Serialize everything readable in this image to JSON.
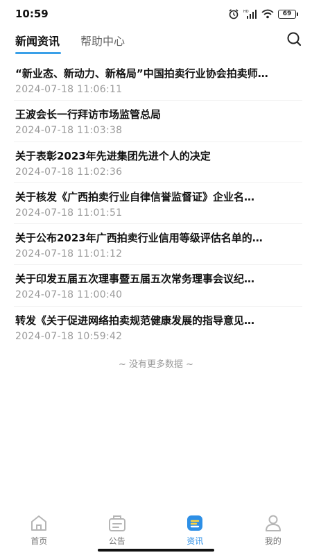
{
  "status_bar": {
    "time": "10:59",
    "battery": "69"
  },
  "top_tabs": [
    {
      "label": "新闻资讯",
      "active": true
    },
    {
      "label": "帮助中心",
      "active": false
    }
  ],
  "news": [
    {
      "title": "“新业态、新动力、新格局”中国拍卖行业协会拍卖师…",
      "time": "2024-07-18 11:06:11"
    },
    {
      "title": "王波会长一行拜访市场监管总局",
      "time": "2024-07-18 11:03:38"
    },
    {
      "title": "关于表彰2023年先进集团先进个人的决定",
      "time": "2024-07-18 11:02:36"
    },
    {
      "title": "关于核发《广西拍卖行业自律信誉监督证》企业名…",
      "time": "2024-07-18 11:01:51"
    },
    {
      "title": "关于公布2023年广西拍卖行业信用等级评估名单的…",
      "time": "2024-07-18 11:01:12"
    },
    {
      "title": "关于印发五届五次理事暨五届五次常务理事会议纪…",
      "time": "2024-07-18 11:00:40"
    },
    {
      "title": "转发《关于促进网络拍卖规范健康发展的指导意见…",
      "time": "2024-07-18 10:59:42"
    }
  ],
  "no_more_text": "~ 没有更多数据 ~",
  "bottom_nav": [
    {
      "label": "首页",
      "icon": "home-icon",
      "active": false
    },
    {
      "label": "公告",
      "icon": "announcement-icon",
      "active": false
    },
    {
      "label": "资讯",
      "icon": "news-icon",
      "active": true
    },
    {
      "label": "我的",
      "icon": "profile-icon",
      "active": false
    }
  ],
  "colors": {
    "accent": "#3aa0e8",
    "nav_active": "#2d8fe6",
    "nav_inactive": "#b5b5b5",
    "time_text": "#9a9a9a"
  }
}
